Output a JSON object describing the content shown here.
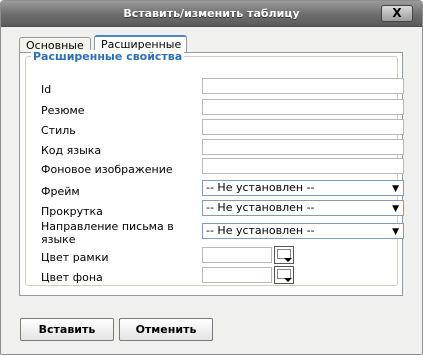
{
  "dialog": {
    "title": "Вставить/изменить таблицу",
    "close_label": "X"
  },
  "tabs": [
    {
      "label": "Основные",
      "active": false
    },
    {
      "label": "Расширенные",
      "active": true
    }
  ],
  "advanced": {
    "legend": "Расширенные свойства",
    "fields": {
      "id": {
        "label": "Id",
        "value": ""
      },
      "summary": {
        "label": "Резюме",
        "value": ""
      },
      "style": {
        "label": "Стиль",
        "value": ""
      },
      "lang_code": {
        "label": "Код языка",
        "value": ""
      },
      "background_image": {
        "label": "Фоновое изображение",
        "value": ""
      },
      "frame": {
        "label": "Фрейм",
        "selected": "-- Не установлен --"
      },
      "scroll": {
        "label": "Прокрутка",
        "selected": "-- Не установлен --"
      },
      "direction": {
        "label": "Направление письма в языке",
        "selected": "-- Не установлен --"
      },
      "border_color": {
        "label": "Цвет рамки",
        "value": ""
      },
      "bg_color": {
        "label": "Цвет фона",
        "value": ""
      }
    }
  },
  "buttons": {
    "insert": "Вставить",
    "cancel": "Отменить"
  },
  "colors": {
    "legend_blue": "#2b6fb6",
    "active_tab_accent": "#4a85c6",
    "titlebar": "#6d6d6d"
  },
  "icons": {
    "dropdown": "chevron-down-icon",
    "color_picker": "color-picker-icon",
    "close": "close-icon"
  }
}
